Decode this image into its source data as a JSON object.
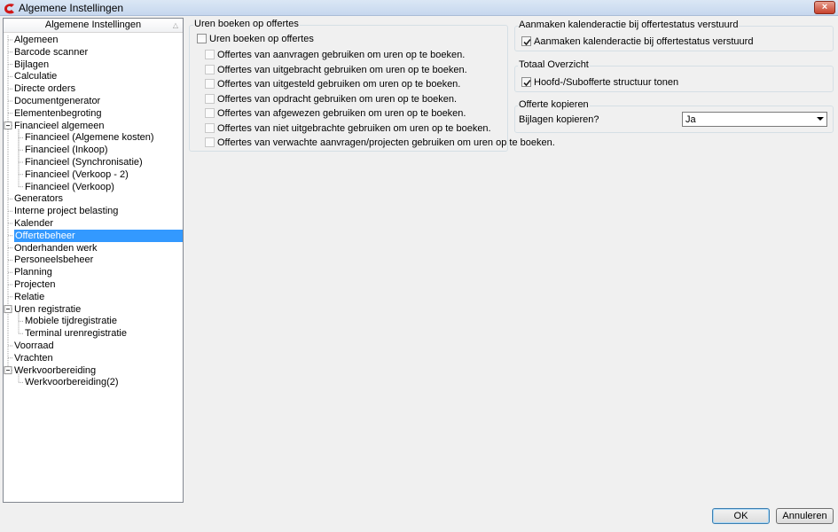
{
  "window": {
    "title": "Algemene Instellingen",
    "close_label": "×"
  },
  "tree": {
    "header": "Algemene Instellingen",
    "items": [
      {
        "label": "Algemeen",
        "level": 0
      },
      {
        "label": "Barcode scanner",
        "level": 0
      },
      {
        "label": "Bijlagen",
        "level": 0
      },
      {
        "label": "Calculatie",
        "level": 0
      },
      {
        "label": "Directe orders",
        "level": 0
      },
      {
        "label": "Documentgenerator",
        "level": 0
      },
      {
        "label": "Elementenbegroting",
        "level": 0
      },
      {
        "label": "Financieel algemeen",
        "level": 0,
        "expanded": true
      },
      {
        "label": "Financieel (Algemene kosten)",
        "level": 1
      },
      {
        "label": "Financieel (Inkoop)",
        "level": 1
      },
      {
        "label": "Financieel (Synchronisatie)",
        "level": 1
      },
      {
        "label": "Financieel (Verkoop - 2)",
        "level": 1
      },
      {
        "label": "Financieel (Verkoop)",
        "level": 1
      },
      {
        "label": "Generators",
        "level": 0
      },
      {
        "label": "Interne project belasting",
        "level": 0
      },
      {
        "label": "Kalender",
        "level": 0
      },
      {
        "label": "Offertebeheer",
        "level": 0,
        "selected": true
      },
      {
        "label": "Onderhanden werk",
        "level": 0
      },
      {
        "label": "Personeelsbeheer",
        "level": 0
      },
      {
        "label": "Planning",
        "level": 0
      },
      {
        "label": "Projecten",
        "level": 0
      },
      {
        "label": "Relatie",
        "level": 0
      },
      {
        "label": "Uren registratie",
        "level": 0,
        "expanded": true
      },
      {
        "label": "Mobiele tijdregistratie",
        "level": 1
      },
      {
        "label": "Terminal urenregistratie",
        "level": 1
      },
      {
        "label": "Voorraad",
        "level": 0
      },
      {
        "label": "Vrachten",
        "level": 0
      },
      {
        "label": "Werkvoorbereiding",
        "level": 0,
        "expanded": true
      },
      {
        "label": "Werkvoorbereiding(2)",
        "level": 1
      }
    ]
  },
  "uren": {
    "title": "Uren boeken op offertes",
    "main_checkbox": {
      "label": "Uren boeken op offertes",
      "checked": false
    },
    "sub_checkboxes": [
      {
        "label": "Offertes van aanvragen gebruiken om uren op te boeken.",
        "checked": false
      },
      {
        "label": "Offertes van uitgebracht gebruiken om uren op te boeken.",
        "checked": false
      },
      {
        "label": "Offertes van uitgesteld gebruiken om uren op te boeken.",
        "checked": false
      },
      {
        "label": "Offertes van opdracht gebruiken om uren op te boeken.",
        "checked": false
      },
      {
        "label": "Offertes van afgewezen gebruiken om uren op te boeken.",
        "checked": false
      },
      {
        "label": "Offertes van niet uitgebrachte gebruiken om uren op te boeken.",
        "checked": false
      },
      {
        "label": "Offertes van verwachte aanvragen/projecten gebruiken om uren op te boeken.",
        "checked": false
      }
    ]
  },
  "kalender": {
    "title": "Aanmaken kalenderactie bij offertestatus verstuurd",
    "checkbox": {
      "label": "Aanmaken kalenderactie bij offertestatus verstuurd",
      "checked": true
    }
  },
  "totaal": {
    "title": "Totaal Overzicht",
    "checkbox": {
      "label": "Hoofd-/Subofferte structuur tonen",
      "checked": true
    }
  },
  "kopieren": {
    "title": "Offerte kopieren",
    "field_label": "Bijlagen kopieren?",
    "selected_value": "Ja"
  },
  "buttons": {
    "ok": "OK",
    "cancel": "Annuleren"
  },
  "colors": {
    "selection": "#3399ff",
    "titlebar": "#c6d7ee"
  }
}
